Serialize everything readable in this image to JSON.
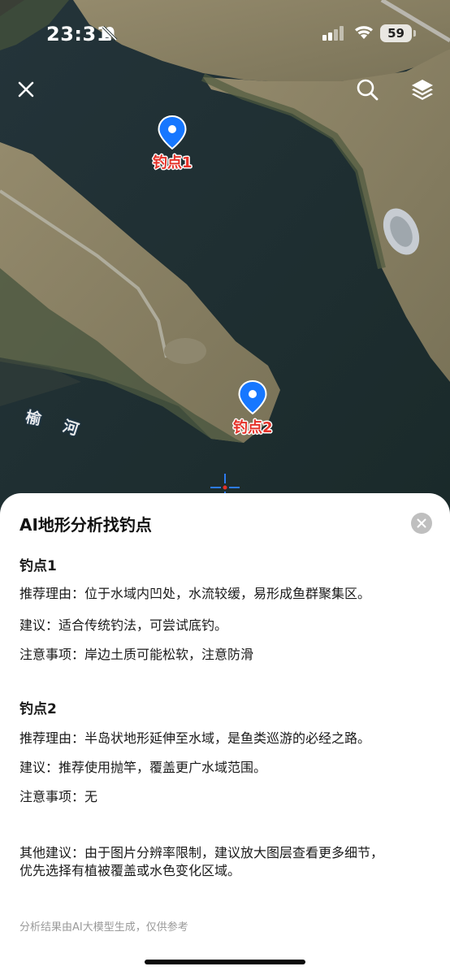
{
  "status_bar": {
    "time": "23:31",
    "battery": "59"
  },
  "map": {
    "markers": [
      {
        "label": "钓点1"
      },
      {
        "label": "钓点2"
      }
    ],
    "river_label": [
      "榆",
      "河"
    ]
  },
  "sheet": {
    "title": "AI地形分析找钓点",
    "spots": [
      {
        "name": "钓点1",
        "reason": "推荐理由：位于水域内凹处，水流较缓，易形成鱼群聚集区。",
        "advice": "建议：适合传统钓法，可尝试底钓。",
        "note": "注意事项：岸边土质可能松软，注意防滑"
      },
      {
        "name": "钓点2",
        "reason": "推荐理由：半岛状地形延伸至水域，是鱼类巡游的必经之路。",
        "advice": "建议：推荐使用抛竿，覆盖更广水域范围。",
        "note": "注意事项：无"
      }
    ],
    "other_line1": "其他建议：由于图片分辨率限制，建议放大图层查看更多细节，",
    "other_line2": "优先选择有植被覆盖或水色变化区域。",
    "footnote": "分析结果由AI大模型生成，仅供参考"
  },
  "colors": {
    "accent_blue": "#1677ff",
    "marker_label_red": "#e53128",
    "water": "#1f2e30",
    "land": "#8a8066"
  }
}
